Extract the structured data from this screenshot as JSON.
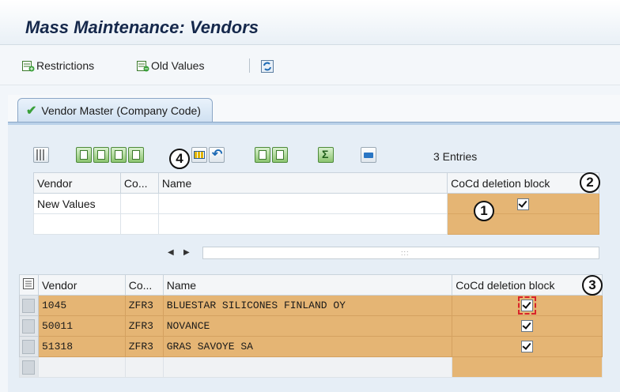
{
  "header": {
    "title": "Mass Maintenance: Vendors"
  },
  "toolbar": {
    "restrictions_label": "Restrictions",
    "old_values_label": "Old Values"
  },
  "tab": {
    "label": "Vendor Master (Company Code)"
  },
  "entries_label": "3 Entries",
  "callouts": {
    "c1": "1",
    "c2": "2",
    "c3": "3",
    "c4": "4"
  },
  "new_values_table": {
    "columns": [
      "Vendor",
      "Co...",
      "Name",
      "CoCd deletion block"
    ],
    "row_label": "New Values",
    "deletion_block_checked": true
  },
  "vendors_table": {
    "columns": [
      "Vendor",
      "Co...",
      "Name",
      "CoCd deletion block"
    ],
    "rows": [
      {
        "vendor": "1045",
        "cocd": "ZFR3",
        "name": "BLUESTAR SILICONES FINLAND OY",
        "deletion_block": true
      },
      {
        "vendor": "50011",
        "cocd": "ZFR3",
        "name": "NOVANCE",
        "deletion_block": true
      },
      {
        "vendor": "51318",
        "cocd": "ZFR3",
        "name": "GRAS SAVOYE SA",
        "deletion_block": true
      }
    ]
  },
  "colors": {
    "highlight": "#e5b574",
    "title": "#15284b",
    "focus": "#d8242a"
  }
}
